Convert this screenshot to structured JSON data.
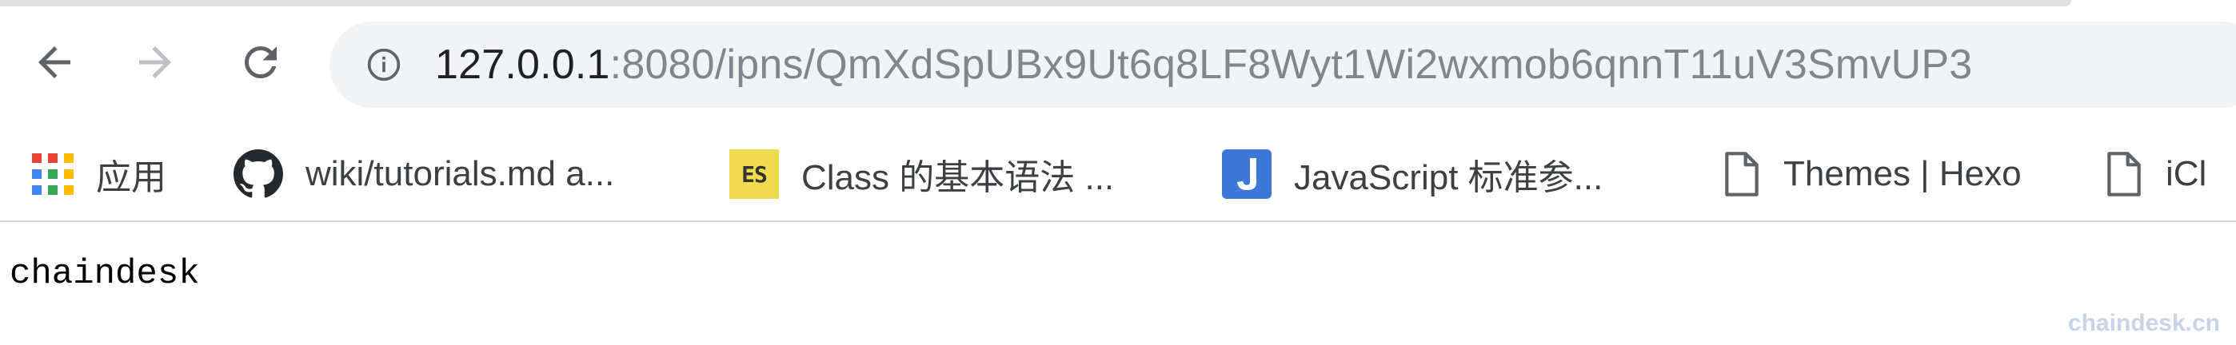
{
  "colors": {
    "omnibox_bg": "#f1f3f4",
    "url_host": "#202124",
    "url_rest": "#80868b",
    "icon": "#5f6368",
    "icon_disabled": "#bdc1c6",
    "es_badge": "#f0db4f",
    "js_badge": "#3b78d8",
    "watermark": "#c7d3e6"
  },
  "toolbar": {
    "back_icon": "arrow-left-icon",
    "forward_icon": "arrow-right-icon",
    "reload_icon": "reload-icon",
    "info_icon": "info-circle-icon"
  },
  "address_bar": {
    "host": "127.0.0.1",
    "rest": ":8080/ipns/QmXdSpUBx9Ut6q8LF8Wyt1Wi2wxmob6qnnT11uV3SmvUP3"
  },
  "bookmarks": [
    {
      "label": "应用",
      "icon": "apps-grid-icon"
    },
    {
      "label": "wiki/tutorials.md a...",
      "icon": "github-icon"
    },
    {
      "label": "Class 的基本语法 ...",
      "icon": "es-badge-icon",
      "badge_text": "ES"
    },
    {
      "label": "JavaScript 标准参...",
      "icon": "js-badge-icon"
    },
    {
      "label": "Themes | Hexo",
      "icon": "document-icon"
    },
    {
      "label": "iCl",
      "icon": "document-icon"
    }
  ],
  "page": {
    "text": "chaindesk"
  },
  "watermark": {
    "text": "chaindesk.cn"
  }
}
